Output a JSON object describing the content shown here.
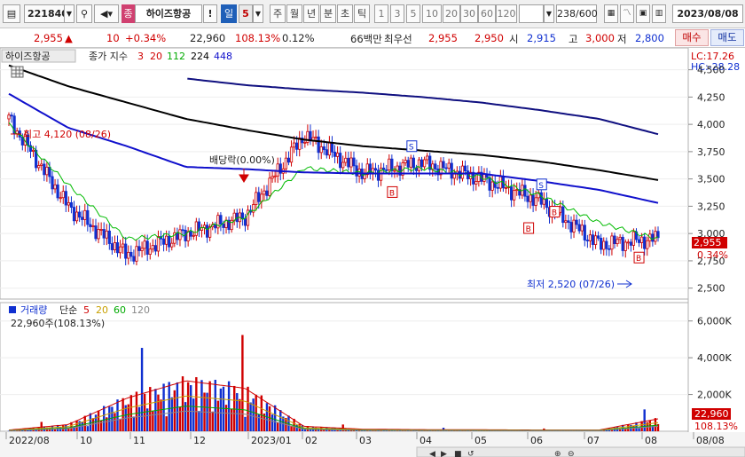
{
  "toolbar": {
    "code": "221840",
    "stock_badge": "종",
    "stock_name": "하이즈항공",
    "excl": "!",
    "period_day": "일",
    "period_num": "5",
    "periods": [
      "주",
      "월",
      "년",
      "분",
      "초",
      "틱"
    ],
    "nums": [
      "1",
      "3",
      "5",
      "10",
      "20",
      "30",
      "60",
      "120"
    ],
    "count": "238",
    "count_total": "/600",
    "date": "2023/08/08"
  },
  "quote": {
    "price": "2,955",
    "arrow": "▲",
    "change": "10",
    "change_pct": "+0.34%",
    "volume": "22,960",
    "vol_ratio": "108.13%",
    "turnover": "0.12%",
    "trade_value": "66백만",
    "best_label": "최우선",
    "ask": "2,955",
    "bid": "2,950",
    "open_label": "시",
    "open": "2,915",
    "high_label": "고",
    "high": "3,000",
    "low_label": "저",
    "low": "2,800",
    "buy_label": "매수",
    "sell_label": "매도"
  },
  "price_panel": {
    "title": "하이즈항공",
    "ma_label": "종가 지수",
    "ma_periods": [
      "3",
      "20",
      "112",
      "224",
      "448"
    ],
    "lc": "LC:17.26",
    "hc": "HC:-28.28",
    "y_ticks": [
      "4,500",
      "4,250",
      "4,000",
      "3,750",
      "3,500",
      "3,250",
      "3,000",
      "2,750",
      "2,500"
    ],
    "y_values": [
      4500,
      4250,
      4000,
      3750,
      3500,
      3250,
      3000,
      2750,
      2500
    ],
    "high_note": "최고 4,120 (08/26)",
    "low_note": "최저 2,520 (07/26)",
    "dividend_note": "배당락(0.00%)",
    "cur_price": "2,955",
    "cur_pct": "0.34%"
  },
  "volume_panel": {
    "title": "거래량",
    "ma_label": "단순",
    "ma_periods": [
      "5",
      "20",
      "60",
      "120"
    ],
    "current": "22,960주(108.13%)",
    "y_ticks": [
      "6,000K",
      "4,000K",
      "2,000K"
    ],
    "y_values": [
      6000,
      4000,
      2000
    ],
    "cur_vol": "22,960",
    "cur_pct": "108.13%"
  },
  "x_axis": [
    "2022/08",
    "10",
    "11",
    "12",
    "2023/01",
    "02",
    "03",
    "04",
    "05",
    "06",
    "07",
    "08",
    "08/08"
  ],
  "colors": {
    "up": "#d00000",
    "down": "#1030d0",
    "ma3": "#d00000",
    "ma20": "#00bb00",
    "ma112": "#1010cc",
    "ma224": "#000000",
    "ma448": "#101080",
    "accent": "#1f5fb8"
  },
  "chart_data": [
    {
      "type": "line",
      "title": "하이즈항공",
      "xlabel": "",
      "ylabel": "",
      "x": [
        "2022/08",
        "10",
        "11",
        "12",
        "2023/01",
        "02",
        "03",
        "04",
        "05",
        "06",
        "07",
        "08"
      ],
      "ylim": [
        2400,
        4700
      ],
      "series": [
        {
          "name": "3",
          "values": [
            4050,
            3250,
            2800,
            3000,
            3150,
            3900,
            3550,
            3650,
            3500,
            3300,
            2900,
            2955
          ]
        },
        {
          "name": "20",
          "values": [
            4000,
            3450,
            2950,
            3000,
            3150,
            3600,
            3550,
            3600,
            3520,
            3350,
            3100,
            2950
          ]
        },
        {
          "name": "112",
          "values": [
            4280,
            3970,
            3800,
            3610,
            3590,
            3560,
            3550,
            3550,
            3550,
            3480,
            3400,
            3280
          ]
        },
        {
          "name": "224",
          "values": [
            4540,
            4350,
            4200,
            4050,
            3950,
            3860,
            3800,
            3760,
            3720,
            3660,
            3580,
            3490
          ]
        },
        {
          "name": "448",
          "values": [
            null,
            null,
            null,
            4420,
            4360,
            4320,
            4290,
            4250,
            4200,
            4130,
            4050,
            3910
          ]
        }
      ],
      "annotations": [
        "최고 4,120 (08/26)",
        "최저 2,520 (07/26)",
        "배당락(0.00%)"
      ]
    },
    {
      "type": "bar",
      "title": "거래량",
      "ylabel": "",
      "ylim": [
        0,
        7000
      ],
      "categories": [
        "2022/08",
        "10",
        "11",
        "12",
        "2023/01",
        "02",
        "03",
        "04",
        "05",
        "06",
        "07",
        "08"
      ],
      "values": [
        150,
        800,
        4000,
        6100,
        5200,
        600,
        250,
        200,
        180,
        150,
        150,
        1500
      ]
    }
  ]
}
